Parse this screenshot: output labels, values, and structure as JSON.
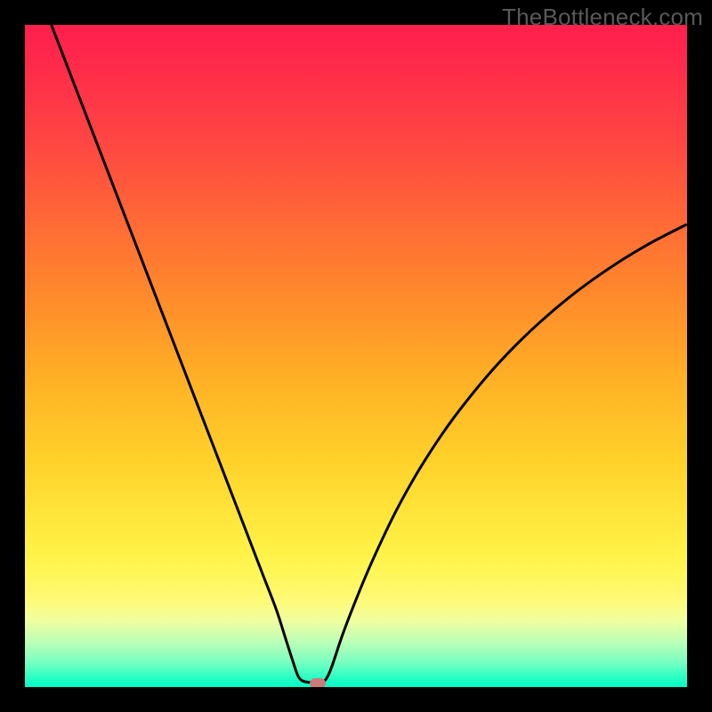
{
  "watermark": "TheBottleneck.com",
  "chart_data": {
    "type": "line",
    "title": "",
    "xlabel": "",
    "ylabel": "",
    "xlim": [
      0,
      100
    ],
    "ylim": [
      0,
      100
    ],
    "series": [
      {
        "name": "bottleneck-curve",
        "x": [
          4,
          6,
          8,
          10,
          12,
          14,
          16,
          18,
          20,
          22,
          24,
          26,
          28,
          30,
          32,
          34,
          36,
          38,
          39.5,
          41,
          41.5,
          42,
          43,
          44,
          44.8,
          46,
          48,
          50,
          52,
          54,
          56,
          58,
          60,
          63,
          66,
          70,
          74,
          78,
          82,
          86,
          90,
          94,
          98,
          99.8
        ],
        "values": [
          100,
          94.8,
          89.6,
          84.4,
          79.2,
          74.0,
          68.8,
          63.6,
          58.4,
          53.2,
          48.0,
          42.8,
          37.6,
          32.4,
          27.2,
          22.0,
          16.8,
          11.6,
          6.9,
          2.3,
          1.3,
          0.9,
          0.7,
          0.6,
          0.6,
          2.2,
          8.0,
          13.2,
          18.0,
          22.4,
          26.5,
          30.2,
          33.6,
          38.2,
          42.3,
          47.2,
          51.5,
          55.3,
          58.7,
          61.7,
          64.4,
          66.8,
          68.9,
          69.8
        ]
      }
    ],
    "marker": {
      "x": 44.2,
      "y": 0.6,
      "color": "#cc7a7a"
    },
    "gradient_stops": [
      {
        "pos": 0,
        "color": "#ff1f4d"
      },
      {
        "pos": 6,
        "color": "#ff2a4a"
      },
      {
        "pos": 18,
        "color": "#ff4742"
      },
      {
        "pos": 30,
        "color": "#ff6a35"
      },
      {
        "pos": 42,
        "color": "#ff8d2b"
      },
      {
        "pos": 54,
        "color": "#ffb225"
      },
      {
        "pos": 66,
        "color": "#ffd22a"
      },
      {
        "pos": 79.5,
        "color": "#fff246"
      },
      {
        "pos": 83,
        "color": "#fff658"
      },
      {
        "pos": 87,
        "color": "#fffa79"
      },
      {
        "pos": 90,
        "color": "#f0ffa0"
      },
      {
        "pos": 93,
        "color": "#bfffb5"
      },
      {
        "pos": 96,
        "color": "#7effc0"
      },
      {
        "pos": 98.2,
        "color": "#36ffc4"
      },
      {
        "pos": 100,
        "color": "#00ffc6"
      }
    ]
  }
}
